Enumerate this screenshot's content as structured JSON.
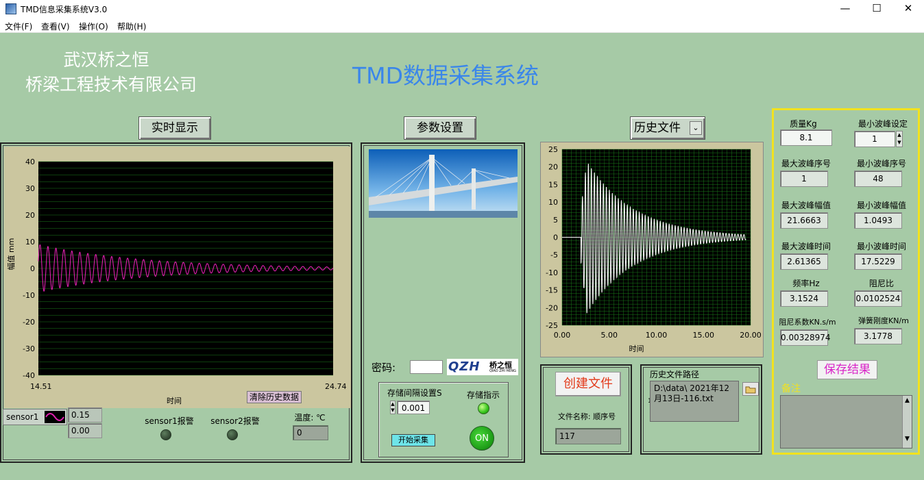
{
  "window": {
    "title": "TMD信息采集系统V3.0",
    "min": "—",
    "max": "☐",
    "close": "✕"
  },
  "menu": [
    "文件(F)",
    "查看(V)",
    "操作(O)",
    "帮助(H)"
  ],
  "header": {
    "company_line1": "武汉桥之恒",
    "company_line2": "桥梁工程技术有限公司",
    "system_title": "TMD数据采集系统"
  },
  "tabs": {
    "realtime": "实时显示",
    "params": "参数设置",
    "history": "历史文件"
  },
  "realtime": {
    "ylabel": "幅值 mm",
    "xlabel": "时间",
    "x_start": "14.51",
    "x_end": "24.74",
    "clear_button": "清除历史数据",
    "sensor_name": "sensor1",
    "value1": "0.15",
    "value2": "0.00",
    "alarm1": "sensor1报警",
    "alarm2": "sensor2报警",
    "temp_label": "温度: ℃",
    "temp_value": "0"
  },
  "params": {
    "password_label": "密码:",
    "logo_text": "QZH",
    "logo_cn": "桥之恒",
    "logo_sub": "QIAO ZHI HENG",
    "interval_label": "存储间隔设置S",
    "interval_value": "0.001",
    "store_indicator": "存储指示",
    "start_button": "开始采集",
    "on_button": "ON"
  },
  "history": {
    "xlabel": "时间",
    "create_button": "创建文件",
    "file_name_label": "文件名称: 顺序号",
    "file_seq": "117",
    "path_label": "历史文件路径",
    "path_value": "D:\\data\\ 2021年12月13日-116.txt",
    "path_marker": "1",
    "folder_icon": "folder-icon"
  },
  "results": {
    "mass_label": "质量Kg",
    "mass": "8.1",
    "min_peak_set_label": "最小波峰设定",
    "min_peak_set": "1",
    "max_peak_no_label": "最大波峰序号",
    "max_peak_no": "1",
    "min_peak_no_label": "最小波峰序号",
    "min_peak_no": "48",
    "max_peak_amp_label": "最大波峰幅值",
    "max_peak_amp": "21.6663",
    "min_peak_amp_label": "最小波峰幅值",
    "min_peak_amp": "1.0493",
    "max_peak_time_label": "最大波峰时间",
    "max_peak_time": "2.61365",
    "min_peak_time_label": "最小波峰时间",
    "min_peak_time": "17.5229",
    "freq_label": "频率Hz",
    "freq": "3.1524",
    "damp_ratio_label": "阻尼比",
    "damp_ratio": "0.0102524",
    "damp_coef_label": "阻尼系数KN.s/m",
    "damp_coef": "0.00328974",
    "stiffness_label": "弹簧刚度KN/m",
    "stiffness": "3.1778",
    "save_button": "保存结果",
    "remark_label": "备注"
  },
  "colors": {
    "bg": "#a6caa6",
    "plot_bg": "#000000",
    "grid": "#1a7a1a",
    "realtime_line": "#e020b0",
    "history_line": "#ffffff",
    "highlight": "#f2e21e",
    "title": "#3a86ea"
  },
  "chart_data": [
    {
      "type": "line",
      "series": [
        {
          "name": "sensor1",
          "x_range": [
            14.51,
            24.74
          ],
          "peak_amplitude_start": 9,
          "decays_to": 0.3
        }
      ],
      "ylabel": "幅值 mm",
      "xlabel": "时间",
      "ylim": [
        -40,
        40
      ],
      "yticks": [
        -40,
        -30,
        -20,
        -10,
        0,
        10,
        20,
        30,
        40
      ],
      "xticks": [
        "14.51",
        "24.74"
      ],
      "grid": true
    },
    {
      "type": "line",
      "series": [
        {
          "x_range": [
            0,
            20
          ],
          "peak_amplitude": 21.67,
          "peak_time": 2.61,
          "frequency_hz": 3.15
        }
      ],
      "xlabel": "时间",
      "ylim": [
        -25,
        25
      ],
      "yticks": [
        -25,
        -20,
        -15,
        -10,
        -5,
        0,
        5,
        10,
        15,
        20,
        25
      ],
      "xlim": [
        0,
        20
      ],
      "xticks": [
        "0.00",
        "5.00",
        "10.00",
        "15.00",
        "20.00"
      ],
      "grid": true
    }
  ]
}
